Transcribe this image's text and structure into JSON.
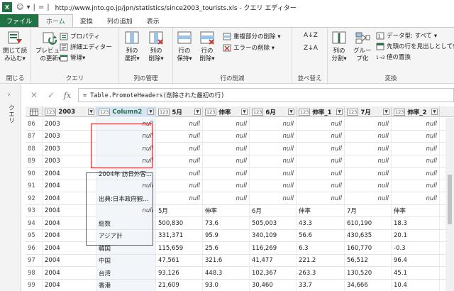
{
  "window": {
    "app_icon": "X",
    "title": "http://www.jnto.go.jp/jpn/statistics/since2003_tourists.xls - クエリ エディター"
  },
  "tabs": [
    {
      "label": "ファイル"
    },
    {
      "label": "ホーム"
    },
    {
      "label": "変換"
    },
    {
      "label": "列の追加"
    },
    {
      "label": "表示"
    }
  ],
  "ribbon": {
    "close": {
      "label1": "閉じて読",
      "label2": "み込む▾",
      "group": "閉じる"
    },
    "query": {
      "preview1": "プレビュー",
      "preview2": "の更新▾",
      "properties": "プロパティ",
      "advanced": "詳細エディター",
      "manage": "管理▾",
      "group": "クエリ"
    },
    "columns": {
      "select1": "列の",
      "select2": "選択▾",
      "remove1": "列の",
      "remove2": "削除▾",
      "group": "列の管理"
    },
    "rows": {
      "keep1": "行の",
      "keep2": "保持▾",
      "remove1": "行の",
      "remove2": "削除▾",
      "dup": "重複部分の削除 ▾",
      "err": "エラーの削除 ▾",
      "group": "行の削減"
    },
    "sort": {
      "group": "並べ替え"
    },
    "transform": {
      "split1": "列の",
      "split2": "分割▾",
      "group1": "グルー",
      "group2": "プ化",
      "datatype": "データ型: すべて ▾",
      "header": "先頭の行を見出しとして使",
      "replace": "値の置換",
      "group": "変換"
    }
  },
  "leftpane": {
    "label": "クエリ"
  },
  "formula": {
    "text": "= Table.PromoteHeaders(削除された最初の行)"
  },
  "columns": [
    "2003",
    "Column2",
    "5月",
    "伸率",
    "6月",
    "伸率_1",
    "7月",
    "伸率_2"
  ],
  "rows": [
    {
      "n": "86",
      "c": [
        "2003",
        "null",
        "null",
        "null",
        "null",
        "null",
        "null",
        "null"
      ]
    },
    {
      "n": "87",
      "c": [
        "2003",
        "null",
        "null",
        "null",
        "null",
        "null",
        "null",
        "null"
      ]
    },
    {
      "n": "88",
      "c": [
        "2003",
        "null",
        "null",
        "null",
        "null",
        "null",
        "null",
        "null"
      ]
    },
    {
      "n": "89",
      "c": [
        "2003",
        "null",
        "null",
        "null",
        "null",
        "null",
        "null",
        "null"
      ]
    },
    {
      "n": "90",
      "c": [
        "2004",
        "2004年 訪日外客...",
        "null",
        "null",
        "null",
        "null",
        "null",
        "null"
      ]
    },
    {
      "n": "91",
      "c": [
        "2004",
        "null",
        "null",
        "null",
        "null",
        "null",
        "null",
        "null"
      ]
    },
    {
      "n": "92",
      "c": [
        "2004",
        "出典:日本政府観...",
        "null",
        "null",
        "null",
        "null",
        "null",
        "null"
      ]
    },
    {
      "n": "93",
      "c": [
        "2004",
        "null",
        "5月",
        "伸率",
        "6月",
        "伸率",
        "7月",
        "伸率"
      ]
    },
    {
      "n": "94",
      "c": [
        "2004",
        "総数",
        "500,830",
        "73.6",
        "505,003",
        "43.3",
        "610,190",
        "18.3"
      ]
    },
    {
      "n": "95",
      "c": [
        "2004",
        "アジア計",
        "331,371",
        "95.9",
        "340,109",
        "56.6",
        "430,635",
        "20.1"
      ]
    },
    {
      "n": "96",
      "c": [
        "2004",
        "韓国",
        "115,659",
        "25.6",
        "116,269",
        "6.3",
        "160,770",
        "-0.3"
      ]
    },
    {
      "n": "97",
      "c": [
        "2004",
        "中国",
        "47,561",
        "321.6",
        "41,477",
        "221.2",
        "56,512",
        "96.4"
      ]
    },
    {
      "n": "98",
      "c": [
        "2004",
        "台湾",
        "93,126",
        "448.3",
        "102,367",
        "263.3",
        "130,520",
        "45.1"
      ]
    },
    {
      "n": "99",
      "c": [
        "2004",
        "香港",
        "21,609",
        "93.0",
        "30,460",
        "33.7",
        "34,666",
        "10.4"
      ]
    }
  ],
  "colors": {
    "accent": "#217346",
    "highlight": "#e32626"
  }
}
